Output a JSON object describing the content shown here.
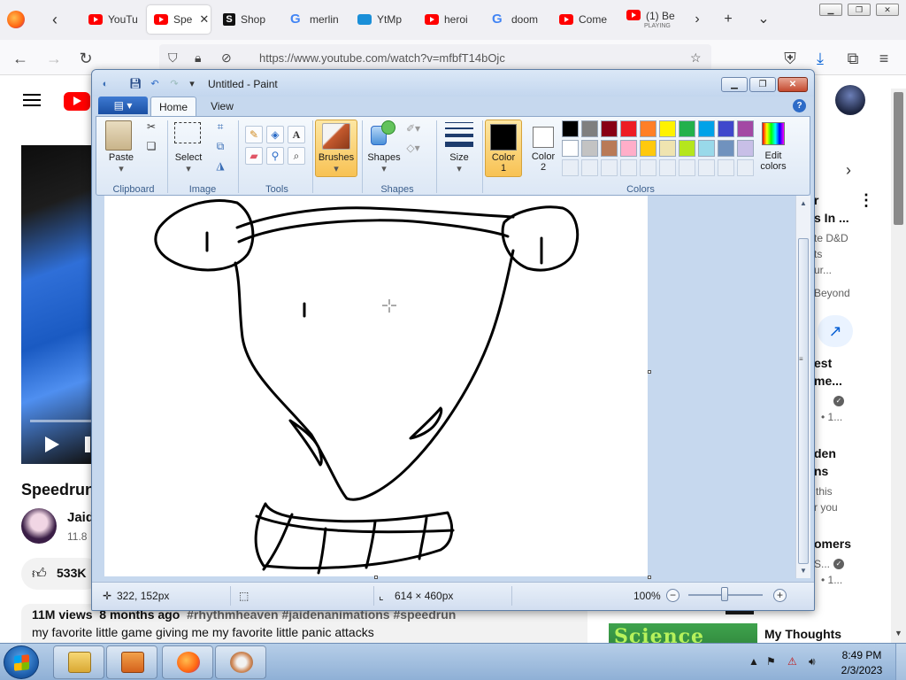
{
  "browser": {
    "tabs": [
      {
        "label": "YouTu",
        "icon": "youtube-icon"
      },
      {
        "label": "Spe",
        "icon": "youtube-icon",
        "active": true
      },
      {
        "label": "Shop",
        "icon": "shop-icon"
      },
      {
        "label": "merlin",
        "icon": "google-icon"
      },
      {
        "label": "YtMp",
        "icon": "ytmp-icon"
      },
      {
        "label": "heroi",
        "icon": "youtube-icon"
      },
      {
        "label": "doom",
        "icon": "google-icon"
      },
      {
        "label": "Come",
        "icon": "youtube-icon"
      },
      {
        "label": "(1) Be",
        "sub": "PLAYING",
        "icon": "youtube-icon"
      }
    ],
    "tab_close": "✕",
    "new_tab": "+",
    "tab_list": "⌄",
    "url": "https://www.youtube.com/watch?v=mfbfT14bOjc",
    "window_buttons": [
      "▁",
      "❐",
      "✕"
    ]
  },
  "youtube": {
    "title": "Speedrun",
    "channel_name": "Jaide",
    "channel_subs": "11.8",
    "likes": "533K",
    "views": "11M views",
    "age": "8 months ago",
    "tags": [
      "#rhythmheaven",
      "#jaidenanimations",
      "#speedrun"
    ],
    "description": "my favorite little game giving me my favorite little panic attacks",
    "sidebar": {
      "item1": {
        "title1": "r",
        "title2": "s In ...",
        "line1": "te D&D",
        "line2": "ts",
        "line3": "ur...",
        "extra": "Beyond"
      },
      "item2": {
        "title1": "est",
        "title2": "me...",
        "meta": "• 1..."
      },
      "item3": {
        "title1": "den",
        "title2": "ns",
        "line1": "this",
        "line2": "r you"
      },
      "item4": {
        "title1": "omers",
        "line1": "S...",
        "meta": "• 1..."
      },
      "thumb_text": "Science Fair",
      "my_thoughts": "My Thoughts"
    }
  },
  "paint": {
    "title": "Untitled - Paint",
    "tabs": {
      "file": "▤ ▾",
      "home": "Home",
      "view": "View"
    },
    "groups": {
      "clipboard": "Clipboard",
      "image": "Image",
      "tools": "Tools",
      "shapes": "Shapes",
      "colors": "Colors"
    },
    "buttons": {
      "paste": "Paste",
      "select": "Select",
      "brushes": "Brushes",
      "shapes": "Shapes",
      "size": "Size",
      "color1": "Color",
      "color1_num": "1",
      "color2": "Color",
      "color2_num": "2",
      "edit_colors": "Edit",
      "edit_colors2": "colors"
    },
    "palette_row1": [
      "#000000",
      "#7f7f7f",
      "#880015",
      "#ed1c24",
      "#ff7f27",
      "#fff200",
      "#22b14c",
      "#00a2e8",
      "#3f48cc",
      "#a349a4"
    ],
    "palette_row2": [
      "#ffffff",
      "#c3c3c3",
      "#b97a57",
      "#ffaec9",
      "#ffc90e",
      "#efe4b0",
      "#b5e61d",
      "#99d9ea",
      "#7092be",
      "#c8bfe7"
    ],
    "color1_value": "#000000",
    "color2_value": "#ffffff",
    "status": {
      "cursor": "322, 152px",
      "canvas_size": "614 × 460px",
      "zoom": "100%"
    }
  },
  "taskbar": {
    "time": "8:49 PM",
    "date": "2/3/2023",
    "apps": [
      "file-explorer-icon",
      "media-player-icon",
      "firefox-icon",
      "paint-icon"
    ]
  }
}
